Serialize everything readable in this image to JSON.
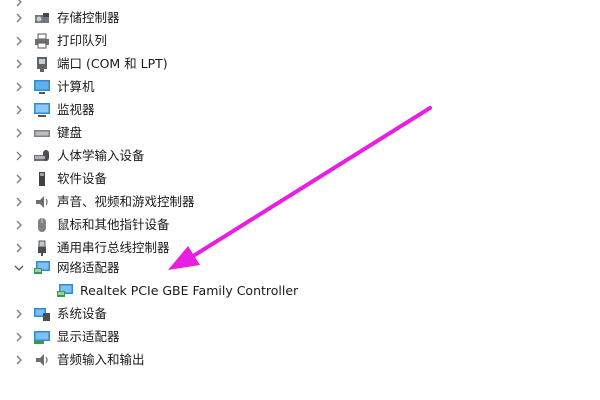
{
  "tree": {
    "items": [
      {
        "label": "存储控制器",
        "icon": "storage-controller-icon",
        "expanded": false
      },
      {
        "label": "打印队列",
        "icon": "printer-icon",
        "expanded": false
      },
      {
        "label": "端口 (COM 和 LPT)",
        "icon": "port-icon",
        "expanded": false
      },
      {
        "label": "计算机",
        "icon": "computer-icon",
        "expanded": false
      },
      {
        "label": "监视器",
        "icon": "monitor-icon",
        "expanded": false
      },
      {
        "label": "键盘",
        "icon": "keyboard-icon",
        "expanded": false
      },
      {
        "label": "人体学输入设备",
        "icon": "hid-icon",
        "expanded": false
      },
      {
        "label": "软件设备",
        "icon": "software-device-icon",
        "expanded": false
      },
      {
        "label": "声音、视频和游戏控制器",
        "icon": "speaker-icon",
        "expanded": false
      },
      {
        "label": "鼠标和其他指针设备",
        "icon": "mouse-icon",
        "expanded": false
      },
      {
        "label": "通用串行总线控制器",
        "icon": "usb-icon",
        "expanded": false
      },
      {
        "label": "网络适配器",
        "icon": "network-adapter-icon",
        "expanded": true
      },
      {
        "label": "Realtek PCIe GBE Family Controller",
        "icon": "network-adapter-icon",
        "child": true
      },
      {
        "label": "系统设备",
        "icon": "system-device-icon",
        "expanded": false
      },
      {
        "label": "显示适配器",
        "icon": "display-adapter-icon",
        "expanded": false
      },
      {
        "label": "音频输入和输出",
        "icon": "audio-io-icon",
        "expanded": false
      }
    ]
  },
  "colors": {
    "arrow": "#e81ee0",
    "icon_blue": "#2f8ad8",
    "chevron": "#7a7a7a"
  }
}
